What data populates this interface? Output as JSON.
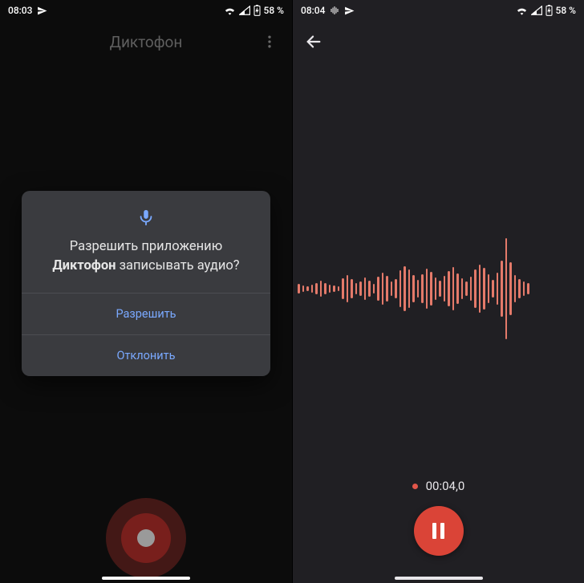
{
  "left": {
    "status": {
      "time": "08:03",
      "battery": "58 %"
    },
    "app_title": "Диктофон",
    "dialog": {
      "line1": "Разрешить приложению",
      "bold": "Диктофон",
      "line2_rest": " записывать аудио?",
      "allow": "Разрешить",
      "deny": "Отклонить"
    }
  },
  "right": {
    "status": {
      "time": "08:04",
      "battery": "58 %"
    },
    "timer": "00:04,0",
    "waveform": [
      12,
      8,
      6,
      10,
      14,
      20,
      14,
      10,
      8,
      6,
      26,
      34,
      24,
      14,
      18,
      28,
      20,
      12,
      30,
      40,
      32,
      18,
      24,
      46,
      56,
      48,
      34,
      22,
      36,
      50,
      42,
      28,
      20,
      32,
      44,
      54,
      38,
      26,
      18,
      30,
      48,
      60,
      52,
      36,
      22,
      40,
      70,
      126,
      66,
      34,
      24,
      18,
      14
    ]
  },
  "colors": {
    "accent_red": "#da4437",
    "wave": "#e47a6a",
    "link_blue": "#7aa9ff"
  }
}
